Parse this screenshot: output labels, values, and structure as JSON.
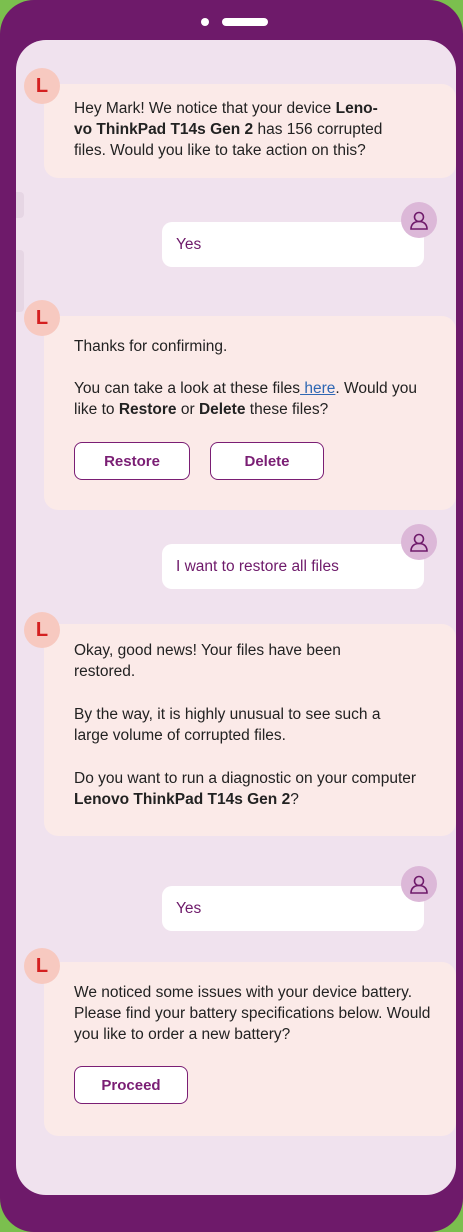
{
  "conversation": {
    "msg1": {
      "avatar_letter": "L",
      "text_before": "Hey Mark! We notice that your device ",
      "device_bold_a": "Leno-",
      "device_bold_b": "vo ThinkPad T14s Gen 2",
      "text_after": " has 156 corrupted files. Would you like to take action on this?"
    },
    "reply1": {
      "text": "Yes"
    },
    "msg2": {
      "avatar_letter": "L",
      "line1": "Thanks for confirming.",
      "line2_before": "You can take a look at these files",
      "line2_link": " here",
      "line2_after": ". Would you like to ",
      "restore_bold": "Restore",
      "or_text": " or ",
      "delete_bold": "Delete",
      "line2_end": " these files?",
      "restore_button": "Restore",
      "delete_button": "Delete"
    },
    "reply2": {
      "text": "I want to restore all files"
    },
    "msg3": {
      "avatar_letter": "L",
      "para1": "Okay, good news! Your files have been restored.",
      "para2": "By the way, it is highly unusual to see such a large volume of corrupted files.",
      "para3_before": "Do you want to run a diagnostic on your computer ",
      "para3_bold": "Lenovo ThinkPad T14s Gen 2",
      "para3_after": "?"
    },
    "reply3": {
      "text": "Yes"
    },
    "msg4": {
      "avatar_letter": "L",
      "text": "We noticed some issues with your device battery. Please find your battery specifications below. Would you like to order a new battery?",
      "proceed_button": "Proceed"
    }
  },
  "icons": {
    "bot_avatar": "bot-avatar-icon",
    "user_avatar": "user-avatar-icon"
  },
  "colors": {
    "frame": "#6e1a6a",
    "screen": "#f0e2ee",
    "bot_card": "#fbeae8",
    "accent_text": "#6e1a6a",
    "brand_red": "#d42020"
  }
}
